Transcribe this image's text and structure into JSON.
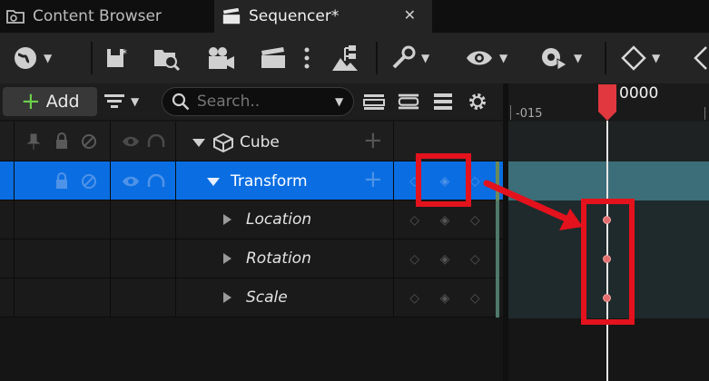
{
  "tabs": [
    {
      "label": "Content Browser",
      "icon": "folder-search-icon",
      "active": false
    },
    {
      "label": "Sequencer*",
      "icon": "clapperboard-icon",
      "active": true
    }
  ],
  "toolbar": {
    "icons": [
      "world-icon",
      "save-icon",
      "find-folder-icon",
      "camera-icon",
      "clapperboard-icon",
      "more-icon",
      "hierarchy-icon",
      "wrench-icon",
      "eye-icon",
      "gear-play-icon",
      "key-diamond-icon"
    ]
  },
  "controls": {
    "add_label": "Add",
    "search_placeholder": "Search.."
  },
  "timeline": {
    "tick_label": "-015",
    "current_frame": "0000",
    "playhead_color": "#e0383e"
  },
  "tracks": [
    {
      "name": "Cube",
      "level": 0,
      "expanded": true,
      "selected": false,
      "italic": false
    },
    {
      "name": "Transform",
      "level": 1,
      "expanded": true,
      "selected": true,
      "italic": false
    },
    {
      "name": "Location",
      "level": 2,
      "expanded": false,
      "selected": false,
      "italic": true
    },
    {
      "name": "Rotation",
      "level": 2,
      "expanded": false,
      "selected": false,
      "italic": true
    },
    {
      "name": "Scale",
      "level": 2,
      "expanded": false,
      "selected": false,
      "italic": true
    }
  ],
  "colors": {
    "selection": "#0a6ee2",
    "annotation": "#e3121d",
    "transform_track": "#3b6e78",
    "subtrack": "#1f2a2c"
  }
}
